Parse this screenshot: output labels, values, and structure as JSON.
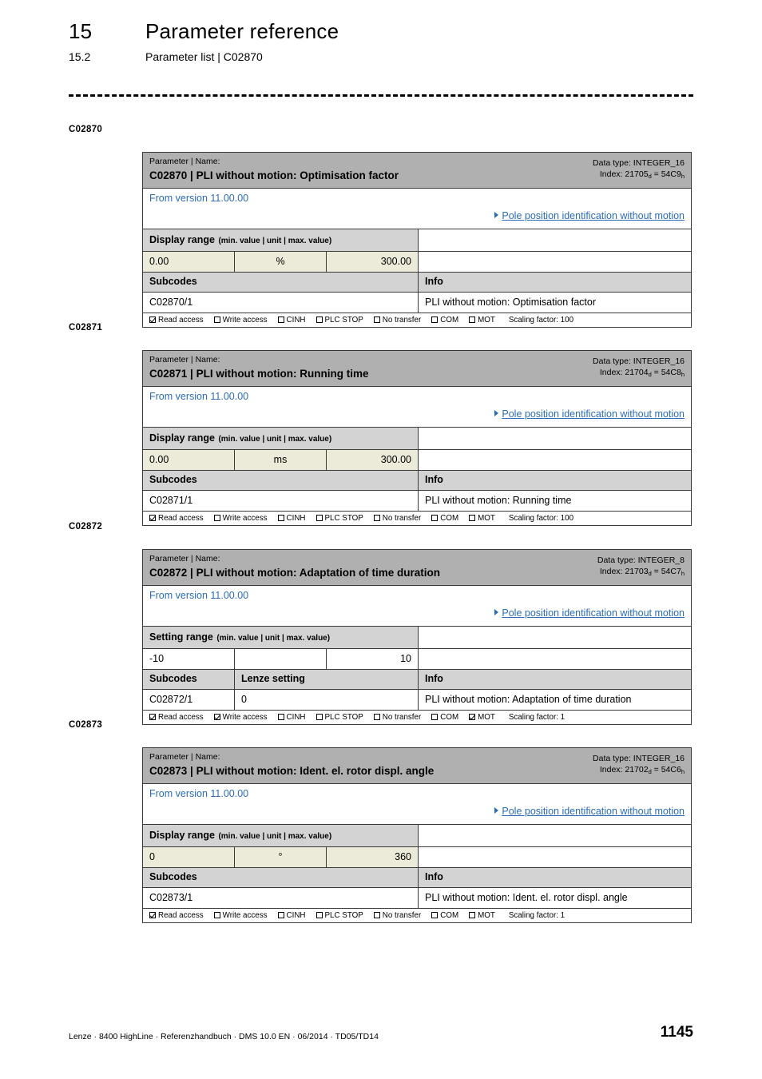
{
  "header": {
    "chapter_number": "15",
    "chapter_title": "Parameter reference",
    "section_number": "15.2",
    "section_title": "Parameter list | C02870"
  },
  "labels": {
    "parameter_name_label": "Parameter | Name:",
    "display_range": "Display range",
    "setting_range": "Setting range",
    "range_note": "(min. value | unit | max. value)",
    "subcodes": "Subcodes",
    "lenze_setting": "Lenze setting",
    "info": "Info",
    "read_access": "Read access",
    "write_access": "Write access",
    "cinh": "CINH",
    "plc_stop": "PLC STOP",
    "no_transfer": "No transfer",
    "com": "COM",
    "mot": "MOT"
  },
  "colors": {
    "link": "#2b6cb8",
    "head_bg": "#b0b0b0",
    "subhead_bg": "#d3d3d3",
    "value_bg": "#ecead8"
  },
  "parameters": [
    {
      "margin_label": "C02870",
      "code": "C02870",
      "name": "PLI without motion: Optimisation factor",
      "title_line": "C02870 | PLI without motion: Optimisation factor",
      "data_type": "Data type: INTEGER_16",
      "index_prefix": "Index: 21705",
      "index_sub_d": "d",
      "index_eq": " = 54C9",
      "index_sub_h": "h",
      "version": "From version 11.00.00",
      "link": "Pole position identification without motion",
      "range_type": "Display range",
      "min": "0.00",
      "unit": "%",
      "max": "300.00",
      "subcode": "C02870/1",
      "info": "PLI without motion: Optimisation factor",
      "lenze_value": null,
      "scaling_factor": "Scaling factor: 100",
      "access": {
        "read": true,
        "write": false,
        "cinh": false,
        "plc_stop": false,
        "no_transfer": false,
        "com": false,
        "mot": false
      }
    },
    {
      "margin_label": "C02871",
      "code": "C02871",
      "name": "PLI without motion: Running time",
      "title_line": "C02871 | PLI without motion: Running time",
      "data_type": "Data type: INTEGER_16",
      "index_prefix": "Index: 21704",
      "index_sub_d": "d",
      "index_eq": " = 54C8",
      "index_sub_h": "h",
      "version": "From version 11.00.00",
      "link": "Pole position identification without motion",
      "range_type": "Display range",
      "min": "0.00",
      "unit": "ms",
      "max": "300.00",
      "subcode": "C02871/1",
      "info": "PLI without motion: Running time",
      "lenze_value": null,
      "scaling_factor": "Scaling factor: 100",
      "access": {
        "read": true,
        "write": false,
        "cinh": false,
        "plc_stop": false,
        "no_transfer": false,
        "com": false,
        "mot": false
      }
    },
    {
      "margin_label": "C02872",
      "code": "C02872",
      "name": "PLI without motion: Adaptation of time duration",
      "title_line": "C02872 | PLI without motion: Adaptation of time duration",
      "data_type": "Data type: INTEGER_8",
      "index_prefix": "Index: 21703",
      "index_sub_d": "d",
      "index_eq": " = 54C7",
      "index_sub_h": "h",
      "version": "From version 11.00.00",
      "link": "Pole position identification without motion",
      "range_type": "Setting range",
      "min": "-10",
      "unit": "",
      "max": "10",
      "subcode": "C02872/1",
      "info": "PLI without motion: Adaptation of time duration",
      "lenze_value": "0",
      "scaling_factor": "Scaling factor: 1",
      "access": {
        "read": true,
        "write": true,
        "cinh": false,
        "plc_stop": false,
        "no_transfer": false,
        "com": false,
        "mot": true
      }
    },
    {
      "margin_label": "C02873",
      "code": "C02873",
      "name": "PLI without motion: Ident.  el. rotor displ. angle",
      "title_line": "C02873 | PLI without motion: Ident.  el. rotor displ. angle",
      "data_type": "Data type: INTEGER_16",
      "index_prefix": "Index: 21702",
      "index_sub_d": "d",
      "index_eq": " = 54C6",
      "index_sub_h": "h",
      "version": "From version 11.00.00",
      "link": "Pole position identification without motion",
      "range_type": "Display range",
      "min": "0",
      "unit": "°",
      "max": "360",
      "subcode": "C02873/1",
      "info": "PLI without motion: Ident.  el. rotor displ. angle",
      "lenze_value": null,
      "scaling_factor": "Scaling factor: 1",
      "access": {
        "read": true,
        "write": false,
        "cinh": false,
        "plc_stop": false,
        "no_transfer": false,
        "com": false,
        "mot": false
      }
    }
  ],
  "footer": {
    "left": "Lenze · 8400 HighLine · Referenzhandbuch · DMS 10.0 EN · 06/2014 · TD05/TD14",
    "page_number": "1145"
  }
}
